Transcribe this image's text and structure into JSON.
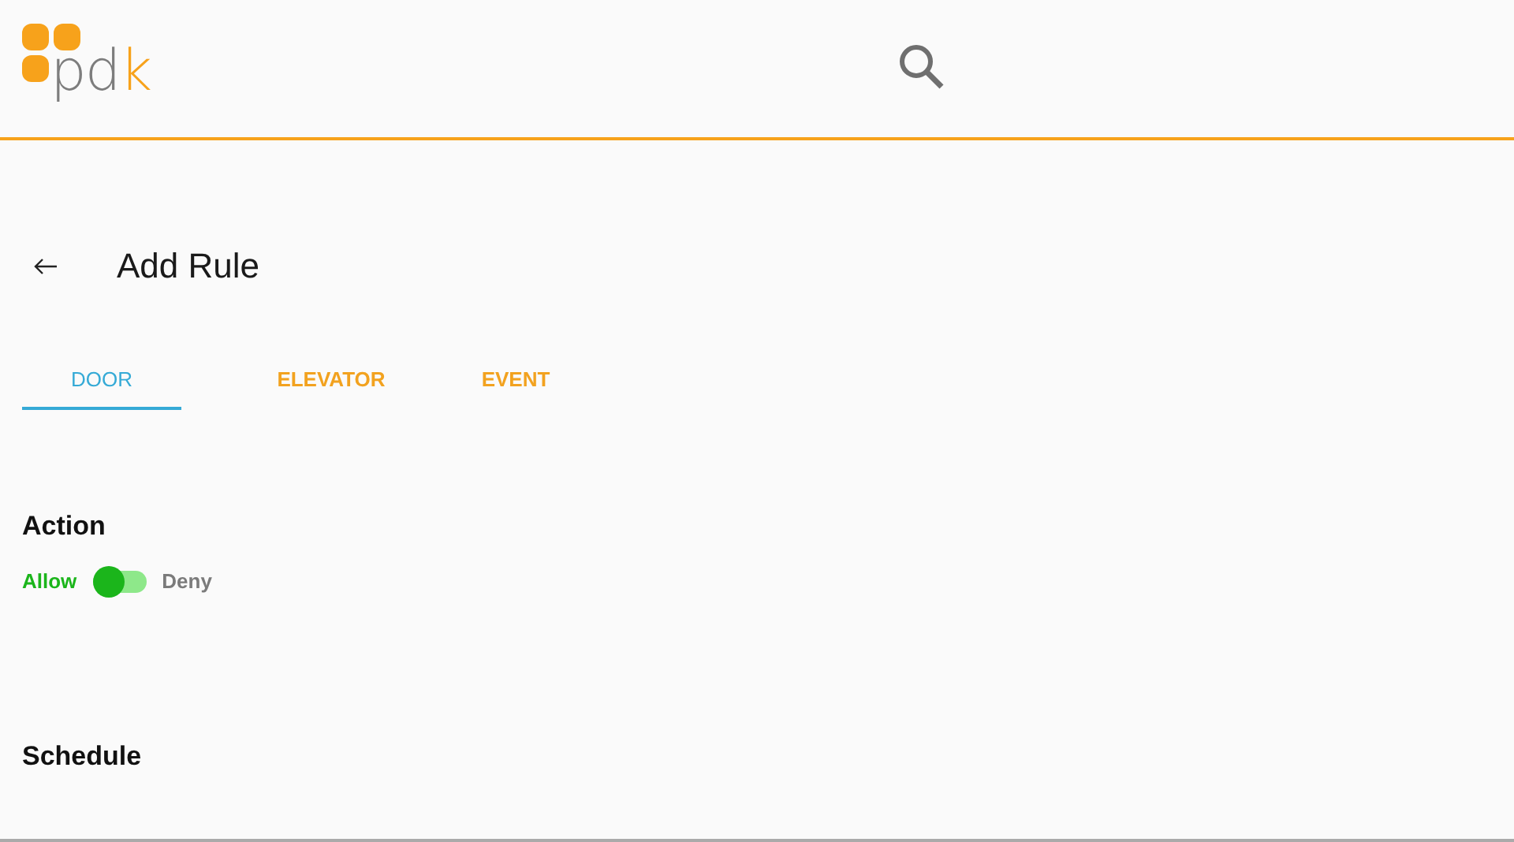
{
  "header": {
    "logo": {
      "main": "pd",
      "accent": "k"
    }
  },
  "page": {
    "title": "Add Rule"
  },
  "tabs": [
    {
      "label": "DOOR",
      "selected": true
    },
    {
      "label": "ELEVATOR",
      "selected": false
    },
    {
      "label": "EVENT",
      "selected": false
    }
  ],
  "action": {
    "heading": "Action",
    "options": [
      {
        "label": "Allow",
        "selected": true
      },
      {
        "label": "Deny",
        "selected": false
      }
    ]
  },
  "schedule": {
    "heading": "Schedule"
  }
}
